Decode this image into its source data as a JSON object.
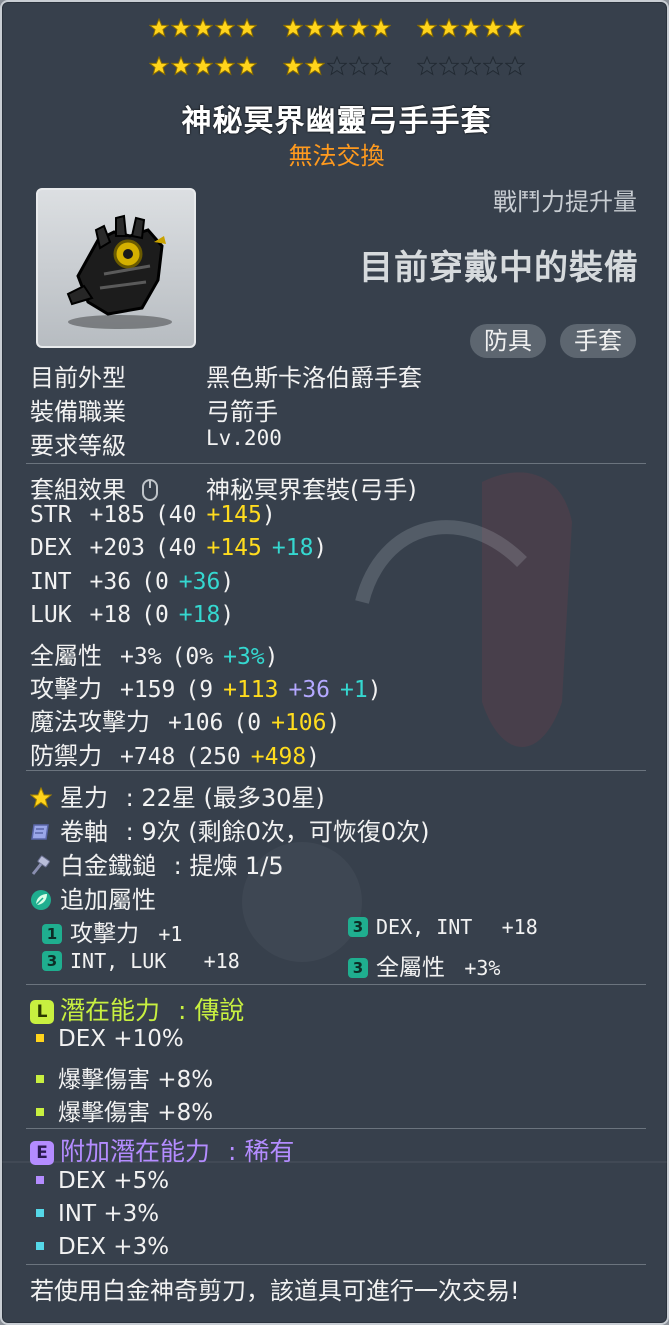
{
  "star_force": {
    "total": 30,
    "filled": 22,
    "groups_per_row": 3,
    "stars_per_group": 5
  },
  "item": {
    "name": "神秘冥界幽靈弓手手套",
    "trade_status": "無法交換",
    "icon": "black-gauntlet-icon"
  },
  "power_label": "戰鬥力提升量",
  "current_equip_label": "目前穿戴中的裝備",
  "tags": [
    "防具",
    "手套"
  ],
  "info": [
    {
      "label": "目前外型",
      "value": "黑色斯卡洛伯爵手套"
    },
    {
      "label": "裝備職業",
      "value": "弓箭手"
    },
    {
      "label": "要求等級",
      "value": "Lv.200"
    }
  ],
  "set_effect": {
    "label": "套組效果",
    "value": "神秘冥界套裝(弓手)",
    "icon": "mouse-icon"
  },
  "stats": [
    {
      "name": "STR",
      "total": "+185",
      "base": "(40",
      "parts": [
        {
          "text": "+145",
          "color": "yellow"
        }
      ],
      "close": ")"
    },
    {
      "name": "DEX",
      "total": "+203",
      "base": "(40",
      "parts": [
        {
          "text": "+145",
          "color": "yellow"
        },
        {
          "text": "+18",
          "color": "green"
        }
      ],
      "close": ")"
    },
    {
      "name": "INT",
      "total": "+36",
      "base": "(0",
      "parts": [
        {
          "text": "+36",
          "color": "green"
        }
      ],
      "close": ")"
    },
    {
      "name": "LUK",
      "total": "+18",
      "base": "(0",
      "parts": [
        {
          "text": "+18",
          "color": "green"
        }
      ],
      "close": ")"
    },
    {
      "name": "全屬性",
      "total": "+3%",
      "base": "(0%",
      "parts": [
        {
          "text": "+3%",
          "color": "green"
        }
      ],
      "close": ")"
    },
    {
      "name": "攻擊力",
      "total": "+159",
      "base": "(9",
      "parts": [
        {
          "text": "+113",
          "color": "yellow"
        },
        {
          "text": "+36",
          "color": "purple"
        },
        {
          "text": "+1",
          "color": "green"
        }
      ],
      "close": ")"
    },
    {
      "name": "魔法攻擊力",
      "total": "+106",
      "base": "(0",
      "parts": [
        {
          "text": "+106",
          "color": "yellow"
        }
      ],
      "close": ")"
    },
    {
      "name": "防禦力",
      "total": "+748",
      "base": "(250",
      "parts": [
        {
          "text": "+498",
          "color": "yellow"
        }
      ],
      "close": ")"
    }
  ],
  "enhance": [
    {
      "icon": "star-icon",
      "label": "星力",
      "value": ":  22星 (最多30星)"
    },
    {
      "icon": "scroll-icon",
      "label": "卷軸",
      "value": ":  9次 (剩餘0次，可恢復0次)"
    },
    {
      "icon": "hammer-icon",
      "label": "白金鐵鎚",
      "value": ":  提煉 1/5"
    },
    {
      "icon": "leaf-icon",
      "label": "追加屬性",
      "value": ""
    }
  ],
  "flames": [
    {
      "tier": "1",
      "label": "攻擊力",
      "value": "+1"
    },
    {
      "tier": "3",
      "label": "DEX, INT",
      "value": "+18"
    },
    {
      "tier": "3",
      "label": "INT, LUK",
      "value": "+18"
    },
    {
      "tier": "3",
      "label": "全屬性",
      "value": "+3%"
    }
  ],
  "potential": {
    "badge": "L",
    "title": "潛在能力",
    "grade": ":  傳說",
    "lines": [
      "DEX +10%",
      "爆擊傷害 +8%",
      "爆擊傷害 +8%"
    ]
  },
  "additional_potential": {
    "badge": "E",
    "title": "附加潛在能力",
    "grade": ":  稀有",
    "lines": [
      "DEX +5%",
      "INT +3%",
      "DEX +3%"
    ]
  },
  "footer": "若使用白金神奇剪刀，該道具可進行一次交易!",
  "colors": {
    "star_filled": "#ffd41c",
    "star_empty": "#3a4450",
    "trade": "#ff9a1e",
    "yellow": "#ffdc1e",
    "green": "#35d8d0",
    "purple": "#b4a8ff",
    "legendary": "#c8f040",
    "epic": "#b48cff"
  }
}
